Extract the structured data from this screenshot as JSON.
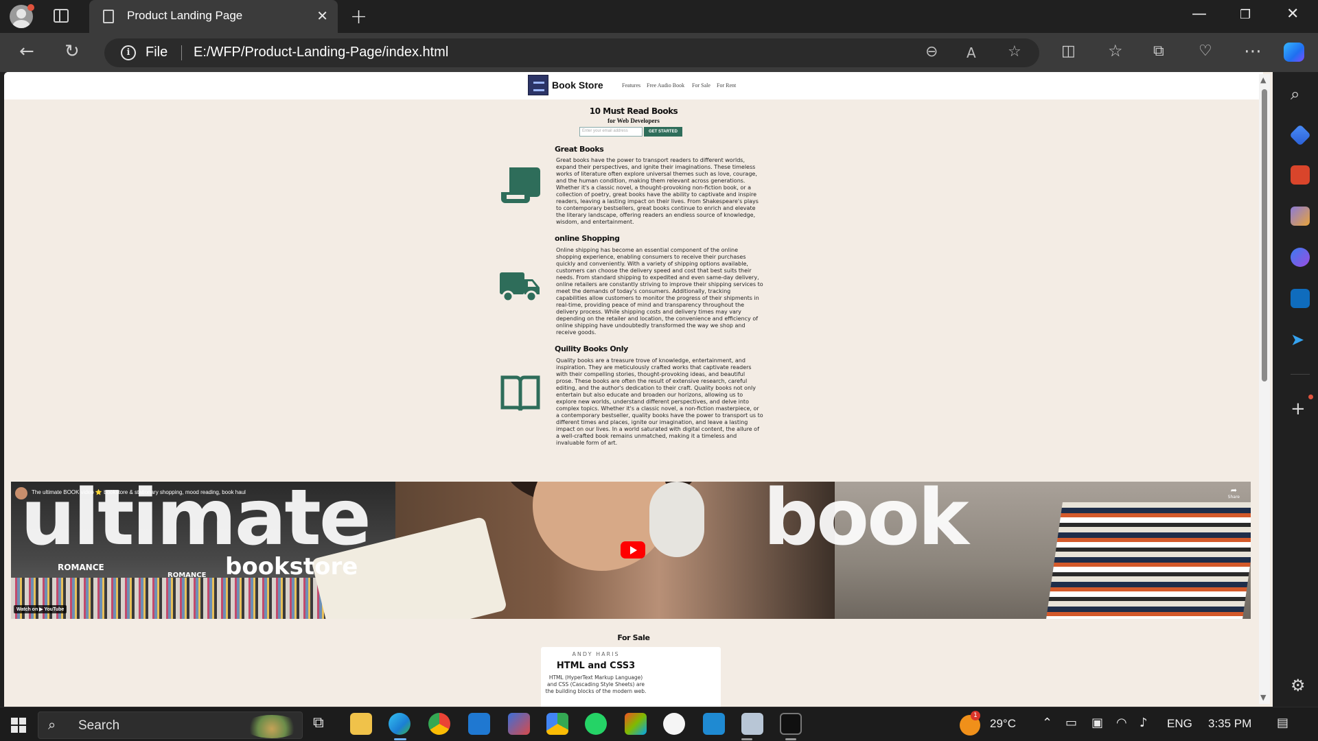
{
  "browser": {
    "tab_title": "Product Landing Page",
    "address_scheme": "File",
    "address_url": "E:/WFP/Product-Landing-Page/index.html"
  },
  "page": {
    "brand": "Book Store",
    "nav": [
      "Features",
      "Free Audio Book",
      "For Sale",
      "For Rent"
    ],
    "hero_title": "10 Must Read Books",
    "hero_subtitle": "for Web Developers",
    "email_placeholder": "Enter your email address",
    "cta_label": "GET STARTED",
    "features": [
      {
        "icon": "scroll-icon",
        "title": "Great Books",
        "text": "Great books have the power to transport readers to different worlds, expand their perspectives, and ignite their imaginations. These timeless works of literature often explore universal themes such as love, courage, and the human condition, making them relevant across generations. Whether it's a classic novel, a thought-provoking non-fiction book, or a collection of poetry, great books have the ability to captivate and inspire readers, leaving a lasting impact on their lives. From Shakespeare's plays to contemporary bestsellers, great books continue to enrich and elevate the literary landscape, offering readers an endless source of knowledge, wisdom, and entertainment."
      },
      {
        "icon": "truck-icon",
        "title": "online Shopping",
        "text": "Online shipping has become an essential component of the online shopping experience, enabling consumers to receive their purchases quickly and conveniently. With a variety of shipping options available, customers can choose the delivery speed and cost that best suits their needs. From standard shipping to expedited and even same-day delivery, online retailers are constantly striving to improve their shipping services to meet the demands of today's consumers. Additionally, tracking capabilities allow customers to monitor the progress of their shipments in real-time, providing peace of mind and transparency throughout the delivery process. While shipping costs and delivery times may vary depending on the retailer and location, the convenience and efficiency of online shipping have undoubtedly transformed the way we shop and receive goods."
      },
      {
        "icon": "open-book-icon",
        "title": "Quility Books Only",
        "text": "Quality books are a treasure trove of knowledge, entertainment, and inspiration. They are meticulously crafted works that captivate readers with their compelling stories, thought-provoking ideas, and beautiful prose. These books are often the result of extensive research, careful editing, and the author's dedication to their craft. Quality books not only entertain but also educate and broaden our horizons, allowing us to explore new worlds, understand different perspectives, and delve into complex topics. Whether it's a classic novel, a non-fiction masterpiece, or a contemporary bestseller, quality books have the power to transport us to different times and places, ignite our imagination, and leave a lasting impact on our lives. In a world saturated with digital content, the allure of a well-crafted book remains unmatched, making it a timeless and invaluable form of art."
      }
    ],
    "video": {
      "title": "The ultimate BOOK video ⭐ bookstore & stationary shopping, mood reading, book haul",
      "overlay_word_1": "ultimate",
      "overlay_word_2": "book",
      "overlay_word_3": "bookstore",
      "shelf_label": "ROMANCE",
      "share_label": "Share",
      "watch_on": "Watch on ▶ YouTube"
    },
    "for_sale_heading": "For Sale",
    "product": {
      "author": "ANDY HARIS",
      "title": "HTML and CSS3",
      "description": "HTML (HyperText Markup Language) and CSS (Cascading Style Sheets) are the building blocks of the modern web."
    }
  },
  "taskbar": {
    "search_label": "Search",
    "temperature": "29°C",
    "weather_badge": "1",
    "language": "ENG",
    "time": "3:35 PM"
  },
  "colors": {
    "page_bg": "#f3ece4",
    "accent_green": "#2e6d5a",
    "icon_green": "#2e6d5a",
    "youtube_red": "#ff0000"
  }
}
